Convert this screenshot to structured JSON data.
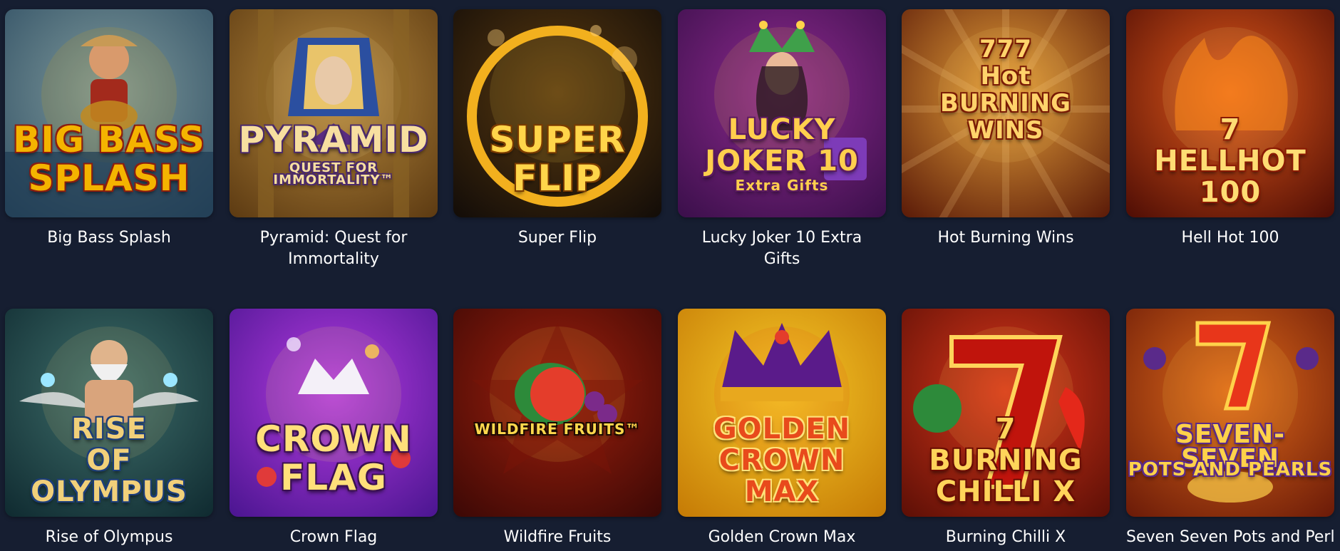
{
  "games": [
    {
      "title": "Big Bass Splash",
      "logo": [
        "BIG BASS",
        "SPLASH"
      ],
      "icon": "fisherman-icon",
      "colors": {
        "bg1": "#7f9a9c",
        "bg2": "#2f4e63",
        "logo": "#f4b400",
        "logo_stroke": "#8a1d10"
      }
    },
    {
      "title": "Pyramid: Quest for Immortality",
      "logo": [
        "PYRAMID",
        "QUEST FOR IMMORTALITY™"
      ],
      "icon": "pharaoh-icon",
      "colors": {
        "bg1": "#b88a3d",
        "bg2": "#5c3a12",
        "logo": "#f7dfa0",
        "logo_stroke": "#4b2a6b"
      }
    },
    {
      "title": "Super Flip",
      "logo": [
        "SUPER",
        "FLIP"
      ],
      "icon": "coin-icon",
      "colors": {
        "bg1": "#5a3a10",
        "bg2": "#120c08",
        "logo": "#ffd54a",
        "logo_stroke": "#7a3b00"
      }
    },
    {
      "title": "Lucky Joker 10 Extra Gifts",
      "logo": [
        "LUCKY",
        "JOKER 10",
        "Extra Gifts"
      ],
      "icon": "joker-icon",
      "colors": {
        "bg1": "#8e2a8f",
        "bg2": "#3a0f4a",
        "logo": "#ffcf4d",
        "logo_stroke": "#5b1a60"
      }
    },
    {
      "title": "Hot Burning Wins",
      "logo": [
        "777",
        "Hot",
        "BURNING",
        "WINS"
      ],
      "icon": "sevens-icon",
      "colors": {
        "bg1": "#e7a13a",
        "bg2": "#5a1a08",
        "logo": "#ffd36b",
        "logo_stroke": "#7a1b05"
      }
    },
    {
      "title": "Hell Hot 100",
      "logo": [
        "7",
        "HELLHOT",
        "100"
      ],
      "icon": "flaming-seven-icon",
      "colors": {
        "bg1": "#e2591a",
        "bg2": "#4e0d05",
        "logo": "#ffdc73",
        "logo_stroke": "#8a1a04"
      }
    },
    {
      "title": "Rise of Olympus",
      "logo": [
        "RISE",
        "OF",
        "OLYMPUS"
      ],
      "icon": "zeus-icon",
      "colors": {
        "bg1": "#3f6f6b",
        "bg2": "#0f2a30",
        "logo": "#f1d07a",
        "logo_stroke": "#1d3e7a"
      }
    },
    {
      "title": "Crown Flag",
      "logo": [
        "CROWN",
        "FLAG"
      ],
      "icon": "crown-flag-icon",
      "colors": {
        "bg1": "#b43be0",
        "bg2": "#4a1590",
        "logo": "#ffe07a",
        "logo_stroke": "#3a1050"
      }
    },
    {
      "title": "Wildfire Fruits",
      "logo": [
        "WILDFIRE FRUITS™"
      ],
      "icon": "watermelon-icon",
      "colors": {
        "bg1": "#a0200d",
        "bg2": "#3b0805",
        "logo": "#ffd84d",
        "logo_stroke": "#1a0a02"
      }
    },
    {
      "title": "Golden Crown Max",
      "logo": [
        "GOLDEN",
        "CROWN",
        "MAX"
      ],
      "icon": "crown-icon",
      "colors": {
        "bg1": "#f6c928",
        "bg2": "#c57a05",
        "logo": "#e84a1c",
        "logo_stroke": "#ffe27a"
      }
    },
    {
      "title": "Burning Chilli X",
      "logo": [
        "7",
        "BURNING",
        "CHILLI X"
      ],
      "icon": "chilli-seven-icon",
      "colors": {
        "bg1": "#d8361a",
        "bg2": "#5c0f06",
        "logo": "#ffd45a",
        "logo_stroke": "#6a0d04"
      }
    },
    {
      "title": "Seven Seven Pots and Perl",
      "logo": [
        "SEVEN-SEVEN",
        "POTS AND PEARLS"
      ],
      "icon": "seven-pots-icon",
      "colors": {
        "bg1": "#e06a1a",
        "bg2": "#6a1a08",
        "logo": "#ffd24a",
        "logo_stroke": "#5a2a8a"
      }
    }
  ]
}
